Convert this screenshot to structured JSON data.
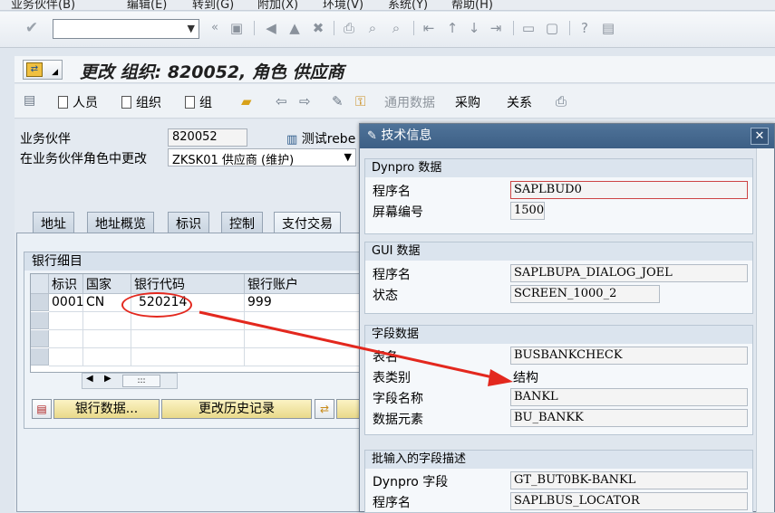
{
  "menu": [
    "业务伙伴(B)",
    "编辑(E)",
    "转到(G)",
    "附加(X)",
    "环境(V)",
    "系统(Y)",
    "帮助(H)"
  ],
  "toolbar": {
    "command_value": ""
  },
  "title": "更改 组织: 820052, 角色 供应商",
  "app_toolbar": {
    "person": "人员",
    "org": "组织",
    "group": "组",
    "general_data": "通用数据",
    "purchasing": "采购",
    "relationships": "关系"
  },
  "form": {
    "bp_label": "业务伙伴",
    "bp_value": "820052",
    "bp_desc": "测试rebe",
    "role_label": "在业务伙伴角色中更改",
    "role_value": "ZKSK01 供应商 (维护)"
  },
  "tabs": [
    "地址",
    "地址概览",
    "标识",
    "控制",
    "支付交易"
  ],
  "bank": {
    "group_title": "银行细目",
    "columns": [
      "标识",
      "国家",
      "银行代码",
      "银行账户"
    ],
    "rows": [
      {
        "id": "0001",
        "country": "CN",
        "bank_key": "520214",
        "account": "999"
      }
    ],
    "scroll_glyph": ":::",
    "btn_bank_data": "银行数据...",
    "btn_history": "更改历史记录"
  },
  "popup": {
    "title": "技术信息",
    "dynpro": {
      "title": "Dynpro 数据",
      "program_label": "程序名",
      "program_value": "SAPLBUD0",
      "screen_label": "屏幕编号",
      "screen_value": "1500"
    },
    "gui": {
      "title": "GUI 数据",
      "program_label": "程序名",
      "program_value": "SAPLBUPA_DIALOG_JOEL",
      "status_label": "状态",
      "status_value": "SCREEN_1000_2"
    },
    "field": {
      "title": "字段数据",
      "table_label": "表名",
      "table_value": "BUSBANKCHECK",
      "table_type_label": "表类别",
      "table_type_value": "结构",
      "field_label": "字段名称",
      "field_value": "BANKL",
      "element_label": "数据元素",
      "element_value": "BU_BANKK"
    },
    "batch": {
      "title": "批输入的字段描述",
      "dynpro_field_label": "Dynpro 字段",
      "dynpro_field_value": "GT_BUT0BK-BANKL",
      "program_label": "程序名",
      "program_value": "SAPLBUS_LOCATOR"
    }
  },
  "annotation": {
    "color": "#e3281e"
  }
}
